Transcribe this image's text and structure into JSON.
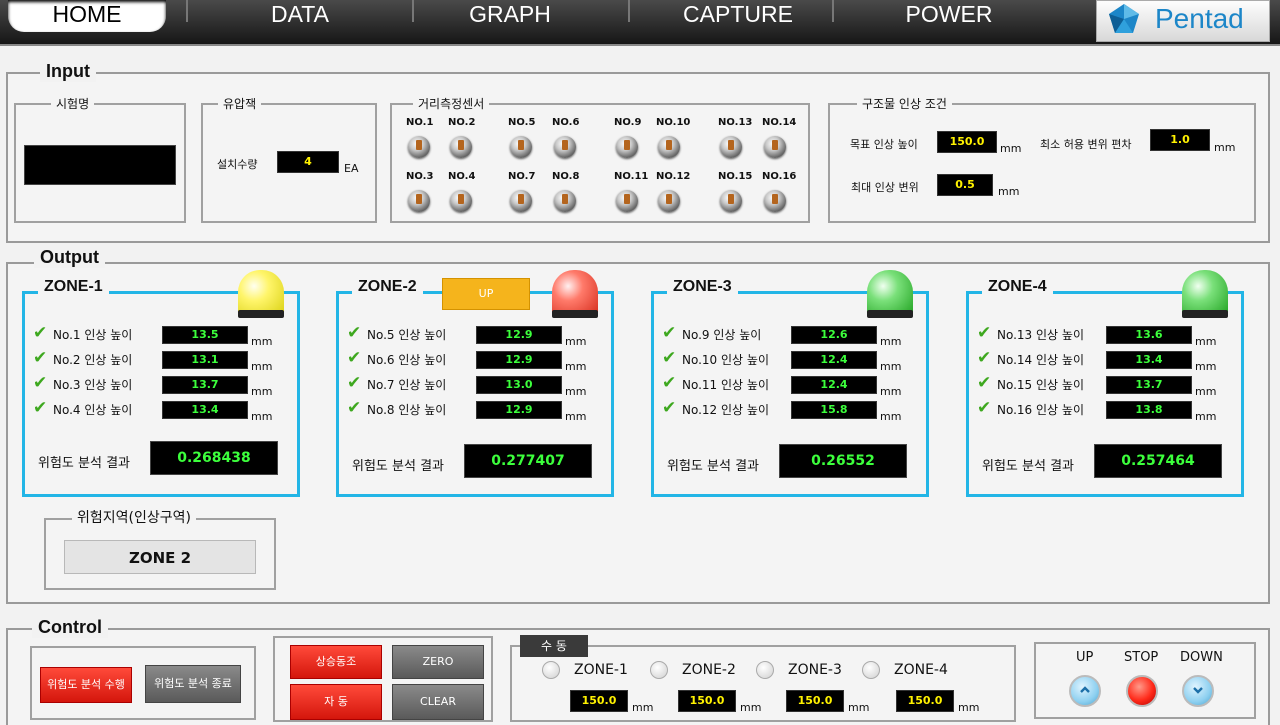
{
  "nav": {
    "tabs": [
      "HOME",
      "DATA",
      "GRAPH",
      "CAPTURE",
      "POWER"
    ],
    "active": "HOME",
    "logo_text": "Pentad",
    "logo_icon": "pentad-gem-icon"
  },
  "input": {
    "title": "Input",
    "test_name": {
      "title": "시험명",
      "value": ""
    },
    "hydraulic_jack": {
      "title": "유압잭",
      "label": "설치수량",
      "value": "4",
      "unit": "EA"
    },
    "distance_sensors": {
      "title": "거리측정센서",
      "labels": [
        "NO.1",
        "NO.2",
        "NO.5",
        "NO.6",
        "NO.9",
        "NO.10",
        "NO.13",
        "NO.14",
        "NO.3",
        "NO.4",
        "NO.7",
        "NO.8",
        "NO.11",
        "NO.12",
        "NO.15",
        "NO.16"
      ]
    },
    "lift_conditions": {
      "title": "구조물 인상 조건",
      "target_label": "목표 인상 높이",
      "target_value": "150.0",
      "target_unit": "mm",
      "min_dev_label": "최소 허용 변위 편차",
      "min_dev_value": "1.0",
      "min_dev_unit": "mm",
      "max_disp_label": "최대 인상 변위",
      "max_disp_value": "0.5",
      "max_disp_unit": "mm"
    }
  },
  "output": {
    "title": "Output",
    "risk_label": "위험도 분석 결과",
    "unit": "mm",
    "zones": [
      {
        "name": "ZONE-1",
        "lamp": "yellow",
        "badge": "",
        "rows": [
          {
            "label": "No.1 인상 높이",
            "value": "13.5"
          },
          {
            "label": "No.2 인상 높이",
            "value": "13.1"
          },
          {
            "label": "No.3 인상 높이",
            "value": "13.7"
          },
          {
            "label": "No.4 인상 높이",
            "value": "13.4"
          }
        ],
        "risk": "0.268438"
      },
      {
        "name": "ZONE-2",
        "lamp": "red",
        "badge": "UP",
        "rows": [
          {
            "label": "No.5 인상 높이",
            "value": "12.9"
          },
          {
            "label": "No.6 인상 높이",
            "value": "12.9"
          },
          {
            "label": "No.7 인상 높이",
            "value": "13.0"
          },
          {
            "label": "No.8 인상 높이",
            "value": "12.9"
          }
        ],
        "risk": "0.277407"
      },
      {
        "name": "ZONE-3",
        "lamp": "green",
        "badge": "",
        "rows": [
          {
            "label": "No.9 인상 높이",
            "value": "12.6"
          },
          {
            "label": "No.10 인상 높이",
            "value": "12.4"
          },
          {
            "label": "No.11 인상 높이",
            "value": "12.4"
          },
          {
            "label": "No.12 인상 높이",
            "value": "15.8"
          }
        ],
        "risk": "0.26552"
      },
      {
        "name": "ZONE-4",
        "lamp": "green",
        "badge": "",
        "rows": [
          {
            "label": "No.13 인상 높이",
            "value": "13.6"
          },
          {
            "label": "No.14 인상 높이",
            "value": "13.4"
          },
          {
            "label": "No.15 인상 높이",
            "value": "13.7"
          },
          {
            "label": "No.16 인상 높이",
            "value": "13.8"
          }
        ],
        "risk": "0.257464"
      }
    ],
    "danger_zone": {
      "title": "위험지역(인상구역)",
      "value": "ZONE 2"
    }
  },
  "control": {
    "title": "Control",
    "analysis_start": "위험도 분석 수행",
    "analysis_stop": "위험도 분석 종료",
    "sync_up": "상승동조",
    "auto": "자 동",
    "zero": "ZERO",
    "clear": "CLEAR",
    "manual": {
      "title": "수 동",
      "zones": [
        "ZONE-1",
        "ZONE-2",
        "ZONE-3",
        "ZONE-4"
      ],
      "values": [
        "150.0",
        "150.0",
        "150.0",
        "150.0"
      ],
      "unit": "mm"
    },
    "motion": {
      "up": "UP",
      "stop": "STOP",
      "down": "DOWN"
    }
  }
}
